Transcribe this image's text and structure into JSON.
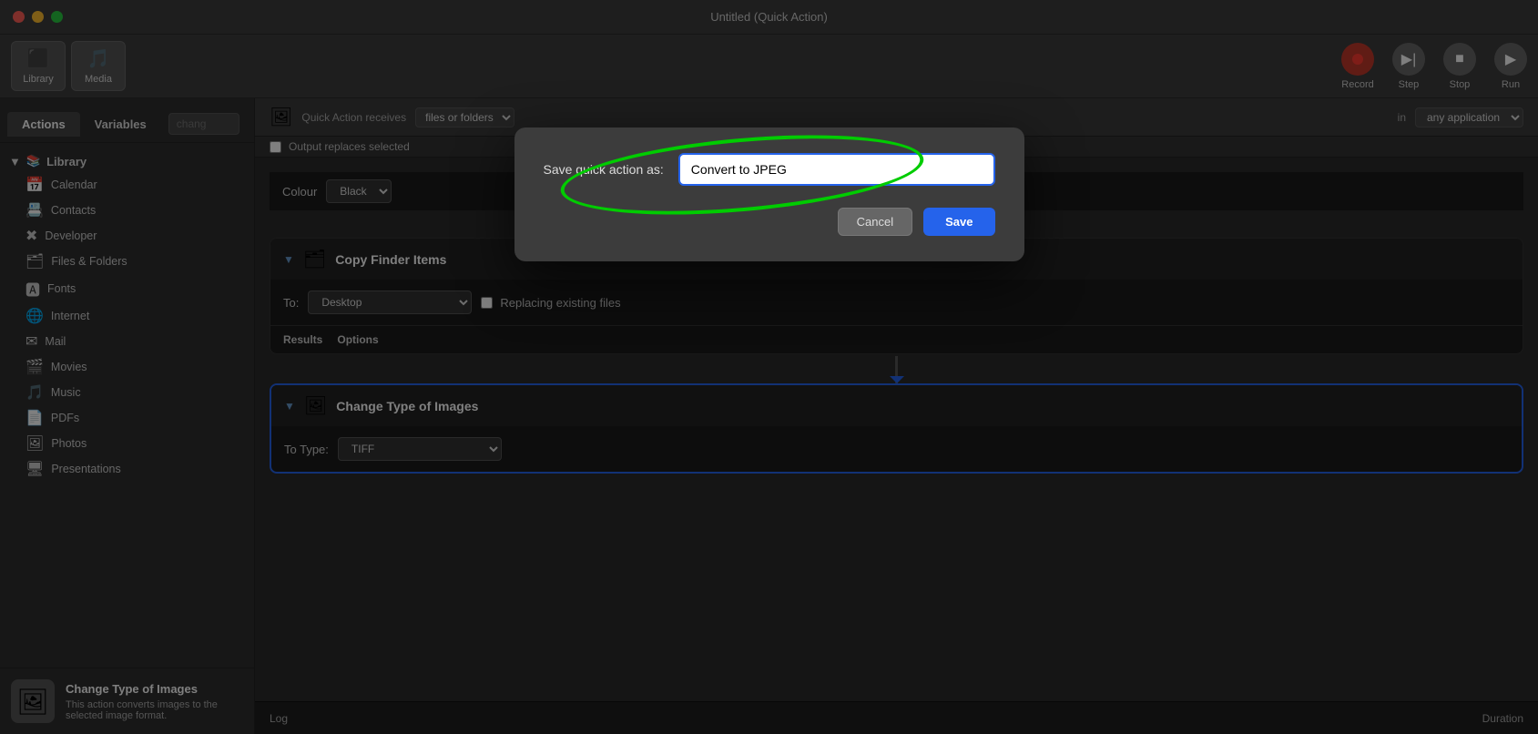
{
  "window": {
    "title": "Untitled (Quick Action)",
    "close_btn": "●",
    "min_btn": "●",
    "max_btn": "●"
  },
  "toolbar": {
    "library_label": "Library",
    "media_label": "Media",
    "record_label": "Record",
    "step_label": "Step",
    "stop_label": "Stop",
    "run_label": "Run"
  },
  "sidebar": {
    "tab_actions": "Actions",
    "tab_variables": "Variables",
    "search_placeholder": "chang",
    "group_label": "Library",
    "items": [
      {
        "label": "Calendar",
        "icon": "📅"
      },
      {
        "label": "Contacts",
        "icon": "📇"
      },
      {
        "label": "Developer",
        "icon": "✖"
      },
      {
        "label": "Files & Folders",
        "icon": "🗂"
      },
      {
        "label": "Fonts",
        "icon": "🅰"
      },
      {
        "label": "Internet",
        "icon": "🌐"
      },
      {
        "label": "Mail",
        "icon": "✉"
      },
      {
        "label": "Movies",
        "icon": "🎬"
      },
      {
        "label": "Music",
        "icon": "🎵"
      },
      {
        "label": "PDFs",
        "icon": "📄"
      },
      {
        "label": "Photos",
        "icon": "🖼"
      },
      {
        "label": "Presentations",
        "icon": "🖥"
      }
    ],
    "bottom_title": "Change Type of Images",
    "bottom_desc": "This action converts images to the selected image format."
  },
  "quick_action_header": {
    "workflow_label": "Quick Action receives",
    "receives_value": "files or folders",
    "in_label": "in",
    "app_value": "any application",
    "output_label": "Output replaces selected",
    "image_icon": "🖼"
  },
  "colour_row": {
    "label": "Colour",
    "value": "Black"
  },
  "copy_finder": {
    "title": "Copy Finder Items",
    "icon": "🗂",
    "to_label": "To:",
    "destination": "Desktop",
    "checkbox_label": "Replacing existing files",
    "results_tab": "Results",
    "options_tab": "Options"
  },
  "change_type": {
    "title": "Change Type of Images",
    "icon": "🖼",
    "to_type_label": "To Type:",
    "type_value": "TIFF"
  },
  "bottom_bar": {
    "log_label": "Log",
    "duration_label": "Duration"
  },
  "modal": {
    "label": "Save quick action as:",
    "input_value": "Convert to JPEG",
    "cancel_label": "Cancel",
    "save_label": "Save"
  }
}
